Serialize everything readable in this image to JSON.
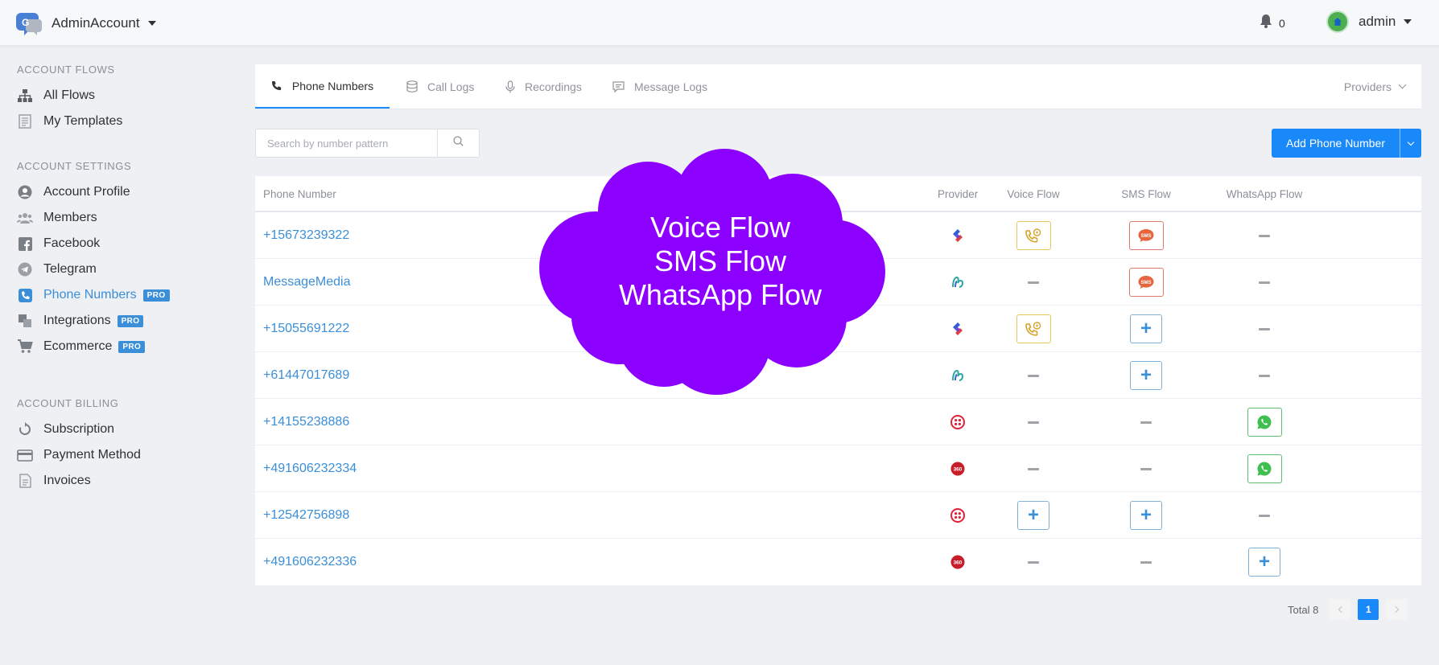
{
  "header": {
    "account_name": "AdminAccount",
    "notifications_count": "0",
    "user_name": "admin"
  },
  "sidebar": {
    "sections": [
      {
        "title": "ACCOUNT FLOWS",
        "items": [
          {
            "label": "All Flows",
            "icon": "sitemap-icon"
          },
          {
            "label": "My Templates",
            "icon": "template-icon"
          }
        ]
      },
      {
        "title": "ACCOUNT SETTINGS",
        "items": [
          {
            "label": "Account Profile",
            "icon": "user-circle-icon"
          },
          {
            "label": "Members",
            "icon": "users-icon"
          },
          {
            "label": "Facebook",
            "icon": "facebook-icon"
          },
          {
            "label": "Telegram",
            "icon": "telegram-icon"
          },
          {
            "label": "Phone Numbers",
            "icon": "phone-icon",
            "badge": "PRO",
            "active": true
          },
          {
            "label": "Integrations",
            "icon": "puzzle-icon",
            "badge": "PRO"
          },
          {
            "label": "Ecommerce",
            "icon": "cart-icon",
            "badge": "PRO"
          }
        ]
      },
      {
        "title": "ACCOUNT BILLING",
        "items": [
          {
            "label": "Subscription",
            "icon": "refresh-icon"
          },
          {
            "label": "Payment Method",
            "icon": "credit-card-icon"
          },
          {
            "label": "Invoices",
            "icon": "invoice-icon"
          }
        ]
      }
    ]
  },
  "tabs": [
    {
      "label": "Phone Numbers",
      "icon": "phone-icon",
      "active": true
    },
    {
      "label": "Call Logs",
      "icon": "database-icon"
    },
    {
      "label": "Recordings",
      "icon": "microphone-icon"
    },
    {
      "label": "Message Logs",
      "icon": "message-icon"
    }
  ],
  "providers_label": "Providers",
  "search": {
    "placeholder": "Search by number pattern"
  },
  "add_button_label": "Add Phone Number",
  "table": {
    "columns": [
      "Phone Number",
      "Provider",
      "Voice Flow",
      "SMS Flow",
      "WhatsApp Flow"
    ],
    "rows": [
      {
        "number": "+15673239322",
        "provider": "signalwire",
        "voice": "flow",
        "sms": "flow",
        "whatsapp": "none"
      },
      {
        "number": "MessageMedia",
        "provider": "messagemedia",
        "voice": "none",
        "sms": "flow",
        "whatsapp": "none"
      },
      {
        "number": "+15055691222",
        "provider": "signalwire",
        "voice": "flow",
        "sms": "add",
        "whatsapp": "none"
      },
      {
        "number": "+61447017689",
        "provider": "messagemedia",
        "voice": "none",
        "sms": "add",
        "whatsapp": "none"
      },
      {
        "number": "+14155238886",
        "provider": "twilio",
        "voice": "none",
        "sms": "none",
        "whatsapp": "flow"
      },
      {
        "number": "+491606232334",
        "provider": "360dialog",
        "voice": "none",
        "sms": "none",
        "whatsapp": "flow"
      },
      {
        "number": "+12542756898",
        "provider": "twilio",
        "voice": "add",
        "sms": "add",
        "whatsapp": "none"
      },
      {
        "number": "+491606232336",
        "provider": "360dialog",
        "voice": "none",
        "sms": "none",
        "whatsapp": "add"
      }
    ]
  },
  "pagination": {
    "total_label": "Total 8",
    "current_page": "1"
  },
  "callout": {
    "lines": [
      "Voice Flow",
      "SMS Flow",
      "WhatsApp Flow"
    ],
    "color": "#8c00ff"
  },
  "colors": {
    "accent": "#1989fa",
    "link": "#3b8fd8",
    "sms": "#e8643c",
    "whatsapp": "#3fbf4f",
    "voice": "#e8b94a"
  }
}
